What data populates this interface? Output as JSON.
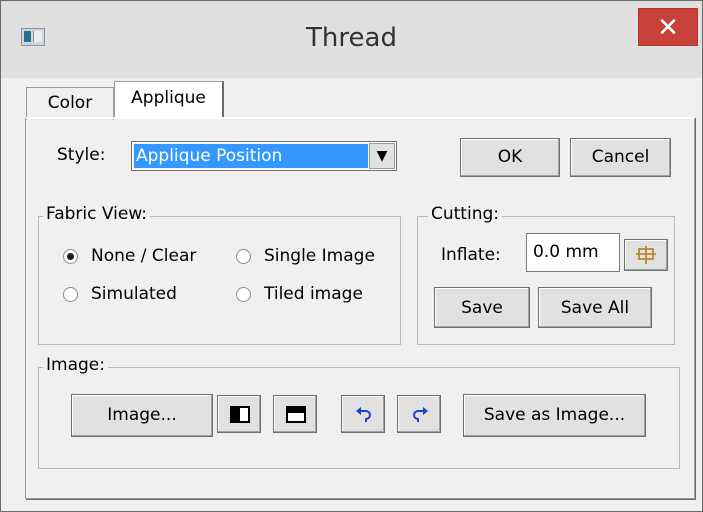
{
  "window": {
    "title": "Thread",
    "close_symbol": "✕"
  },
  "tabs": [
    {
      "label": "Color",
      "selected": false
    },
    {
      "label": "Applique",
      "selected": true
    }
  ],
  "style": {
    "label": "Style:",
    "selected_value": "Applique Position",
    "arrow": "▼"
  },
  "buttons": {
    "ok": "OK",
    "cancel": "Cancel"
  },
  "fabric_view": {
    "label": "Fabric View:",
    "options": [
      {
        "label": "None / Clear",
        "checked": true
      },
      {
        "label": "Single Image",
        "checked": false
      },
      {
        "label": "Simulated",
        "checked": false
      },
      {
        "label": "Tiled image",
        "checked": false
      }
    ]
  },
  "cutting": {
    "label": "Cutting:",
    "inflate_label": "Inflate:",
    "inflate_value": "0.0 mm",
    "save": "Save",
    "save_all": "Save All"
  },
  "image": {
    "label": "Image:",
    "image_button": "Image...",
    "save_as_image": "Save as Image..."
  },
  "colors": {
    "close_button": "#c7413a",
    "selection": "#3399ff",
    "window_bg": "#f0f0f0",
    "icon_arrows": "#1f3fd0"
  }
}
